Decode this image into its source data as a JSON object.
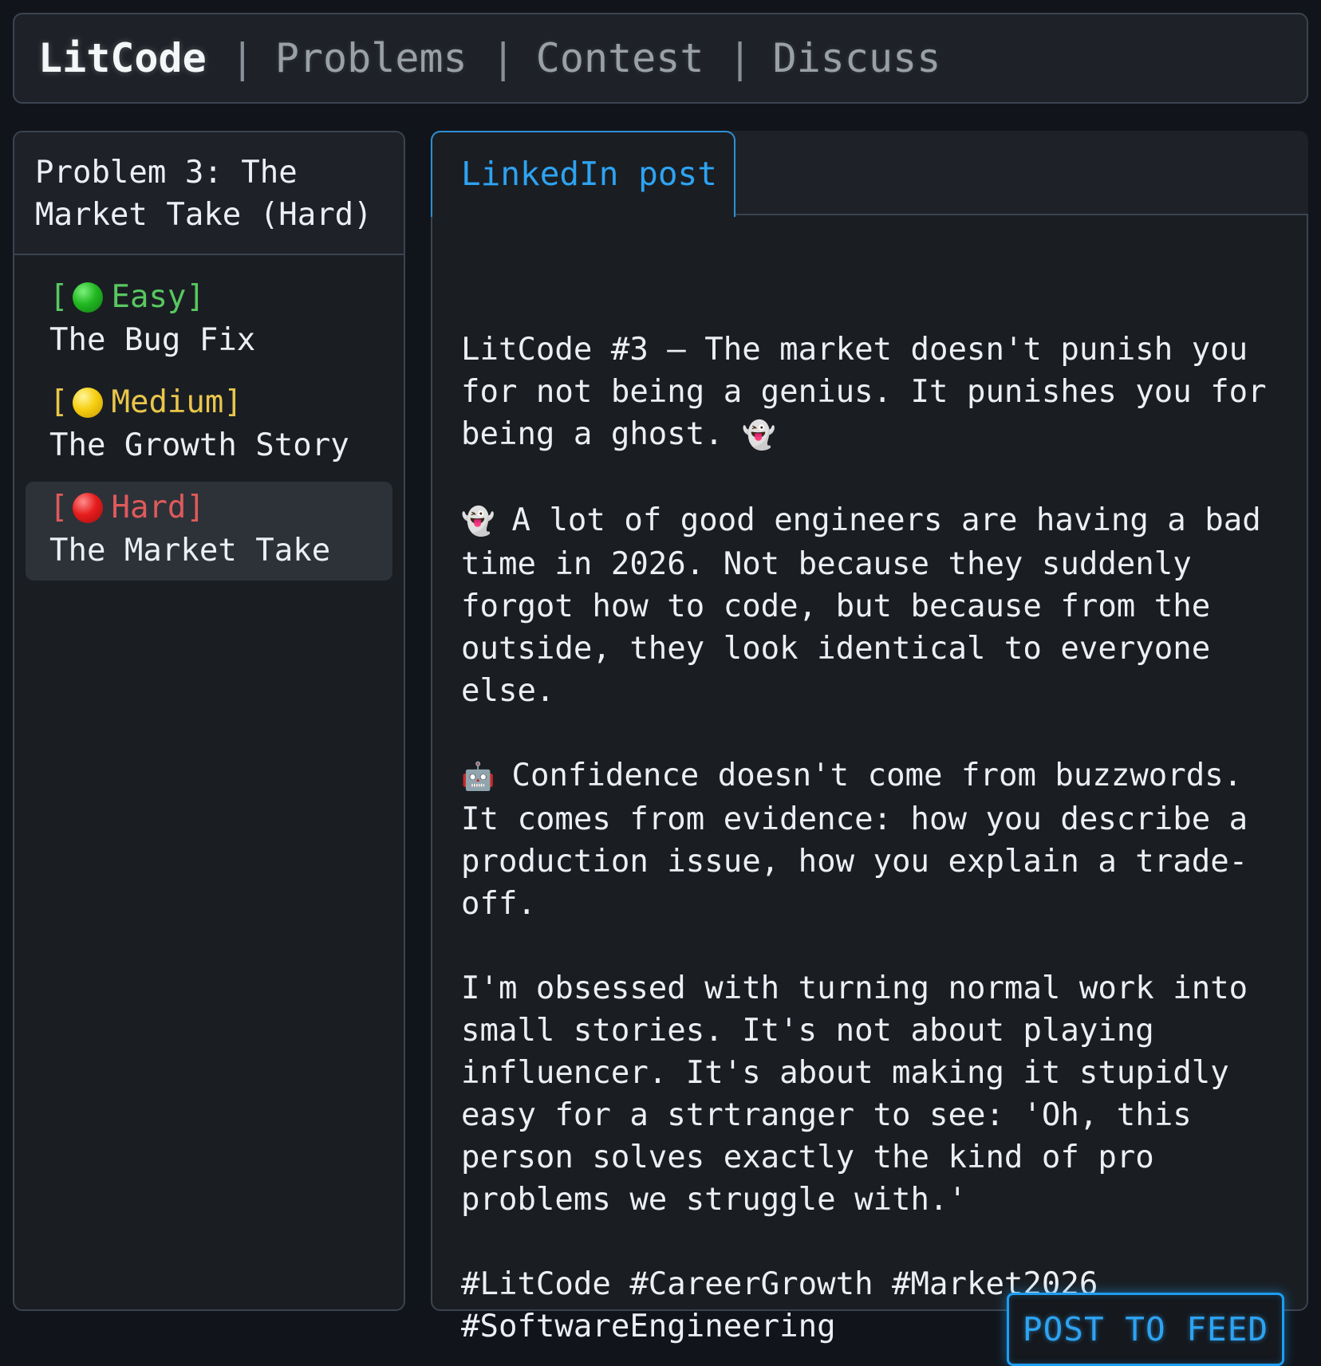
{
  "nav": {
    "brand": "LitCode",
    "separator": "|",
    "links": [
      "Problems",
      "Contest",
      "Discuss"
    ]
  },
  "sidebar": {
    "header_line1": "Problem 3: The",
    "header_line2": "Market Take (Hard)",
    "items": [
      {
        "difficulty": "Easy",
        "open": "[",
        "close": "]",
        "dot": "green-circle",
        "title": "The Bug Fix",
        "active": false
      },
      {
        "difficulty": "Medium",
        "open": "[",
        "close": "]",
        "dot": "yellow-circle",
        "title": "The Growth Story",
        "active": false
      },
      {
        "difficulty": "Hard",
        "open": "[",
        "close": "]",
        "dot": "red-circle",
        "title": "The Market Take",
        "active": true
      }
    ]
  },
  "editor": {
    "tab_label": "LinkedIn post",
    "post": {
      "p1": "LitCode #3 – The market doesn't punish you\nfor not being a genius. It punishes you for\nbeing a ghost. ",
      "p1_emoji": "👻",
      "p2_emoji": "👻",
      "p2": " A lot of good engineers are having a bad\ntime in 2026. Not because they suddenly\nforgot how to code, but because from the\noutside, they look identical to everyone else.",
      "p3_emoji": "🤖",
      "p3": " Confidence doesn't come from buzzwords.\nIt comes from evidence: how you describe a\nproduction issue, how you explain a trade-off.",
      "p4": "I'm obsessed with turning normal work into\nsmall stories. It's not about playing\ninfluencer. It's about making it stupidly\neasy for a strtranger to see: 'Oh, this\nperson solves exactly the kind of pro\nproblems we struggle with.'",
      "p5": "#LitCode #CareerGrowth #Market2026\n#SoftwareEngineering"
    },
    "post_button": "POST TO FEED"
  },
  "colors": {
    "accent": "#2ea3f2",
    "easy": "#58c860",
    "medium": "#e9c64a",
    "hard": "#e05a5a",
    "background": "#11151b"
  }
}
